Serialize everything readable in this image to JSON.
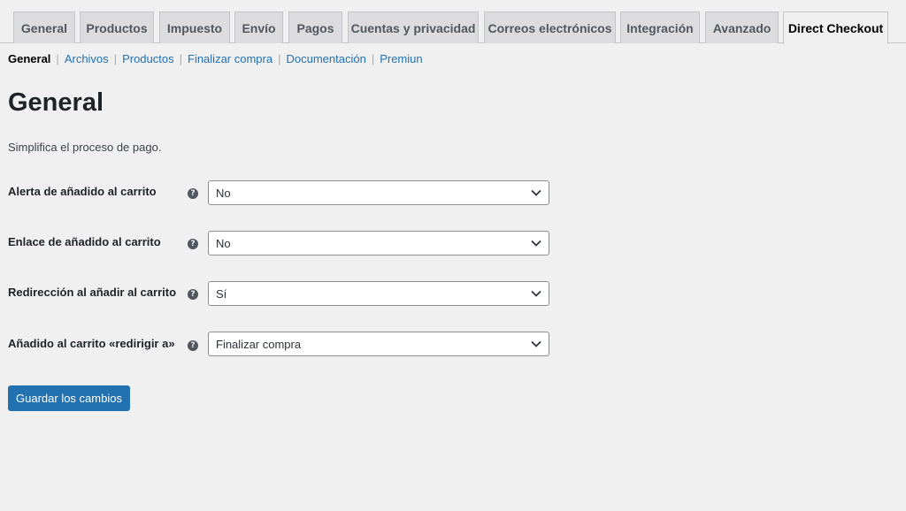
{
  "tabs": [
    {
      "label": "General"
    },
    {
      "label": "Productos"
    },
    {
      "label": "Impuesto"
    },
    {
      "label": "Envío"
    },
    {
      "label": "Pagos"
    },
    {
      "label": "Cuentas y privacidad"
    },
    {
      "label": "Correos electrónicos"
    },
    {
      "label": "Integración"
    },
    {
      "label": "Avanzado"
    },
    {
      "label": "Direct Checkout",
      "active": true
    }
  ],
  "subnav": [
    {
      "label": "General",
      "current": true
    },
    {
      "label": "Archivos"
    },
    {
      "label": "Productos"
    },
    {
      "label": "Finalizar compra"
    },
    {
      "label": "Documentación"
    },
    {
      "label": "Premiun"
    }
  ],
  "subnav_separator": "|",
  "page": {
    "title": "General",
    "description": "Simplifica el proceso de pago."
  },
  "fields": [
    {
      "label": "Alerta de añadido al carrito",
      "value": "No",
      "help_icon": "question-circle-icon"
    },
    {
      "label": "Enlace de añadido al carrito",
      "value": "No",
      "help_icon": "question-circle-icon"
    },
    {
      "label": "Redirección al añadir al carrito",
      "value": "Sí",
      "help_icon": "question-circle-icon"
    },
    {
      "label": "Añadido al carrito «redirigir a»",
      "value": "Finalizar compra",
      "help_icon": "question-circle-icon"
    }
  ],
  "help_glyph": "?",
  "save_label": "Guardar los cambios",
  "colors": {
    "accent": "#2271b1",
    "background": "#f0f0f1",
    "tab_inactive": "#dcdcde"
  }
}
